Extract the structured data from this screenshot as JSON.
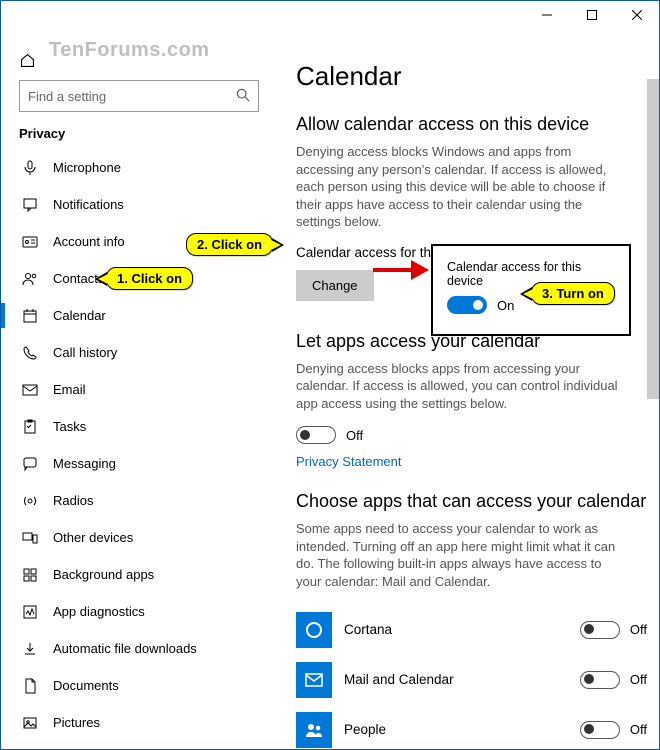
{
  "watermark": "TenForums.com",
  "search_placeholder": "Find a setting",
  "section_title": "Privacy",
  "sidebar": {
    "items": [
      {
        "label": "Microphone"
      },
      {
        "label": "Notifications"
      },
      {
        "label": "Account info"
      },
      {
        "label": "Contacts"
      },
      {
        "label": "Calendar"
      },
      {
        "label": "Call history"
      },
      {
        "label": "Email"
      },
      {
        "label": "Tasks"
      },
      {
        "label": "Messaging"
      },
      {
        "label": "Radios"
      },
      {
        "label": "Other devices"
      },
      {
        "label": "Background apps"
      },
      {
        "label": "App diagnostics"
      },
      {
        "label": "Automatic file downloads"
      },
      {
        "label": "Documents"
      },
      {
        "label": "Pictures"
      }
    ]
  },
  "main": {
    "title": "Calendar",
    "h_allow": "Allow calendar access on this device",
    "desc_allow": "Denying access blocks Windows and apps from accessing any person's calendar. If access is allowed, each person using this device will be able to choose if their apps have access to their calendar using the settings below.",
    "access_state": "Calendar access for this device is off",
    "change_btn": "Change",
    "h_letapps": "Let apps access your calendar",
    "desc_letapps": "Denying access blocks apps from accessing your calendar. If access is allowed, you can control individual app access using the settings below.",
    "toggle_off": "Off",
    "privacy_link": "Privacy Statement",
    "h_choose": "Choose apps that can access your calendar",
    "desc_choose": "Some apps need to access your calendar to work as intended. Turning off an app here might limit what it can do. The following built-in apps always have access to your calendar: Mail and Calendar.",
    "apps": [
      {
        "name": "Cortana",
        "state": "Off"
      },
      {
        "name": "Mail and Calendar",
        "state": "Off"
      },
      {
        "name": "People",
        "state": "Off"
      }
    ]
  },
  "popup": {
    "title": "Calendar access for this device",
    "state": "On"
  },
  "callouts": {
    "c1": "1. Click on",
    "c2": "2. Click on",
    "c3": "3. Turn on"
  }
}
